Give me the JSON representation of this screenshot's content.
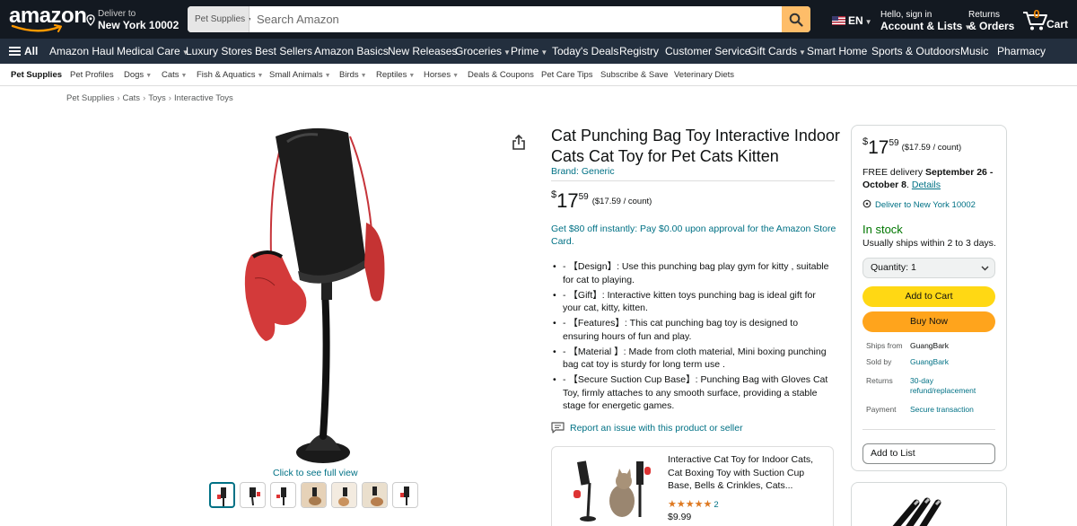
{
  "header": {
    "logo_text": "amazon",
    "deliver_to_label": "Deliver to",
    "deliver_to_location": "New York 10002",
    "search_category": "Pet Supplies",
    "search_placeholder": "Search Amazon",
    "language": "EN",
    "account_greeting": "Hello, sign in",
    "account_label": "Account & Lists",
    "returns_label": "Returns",
    "orders_label": "& Orders",
    "cart_count": "0",
    "cart_label": "Cart"
  },
  "nav": {
    "all_label": "All",
    "items": [
      "Amazon Haul",
      "Medical Care",
      "Luxury Stores",
      "Best Sellers",
      "Amazon Basics",
      "New Releases",
      "Groceries",
      "Prime",
      "Today's Deals",
      "Registry",
      "Customer Service",
      "Gift Cards",
      "Smart Home",
      "Sports & Outdoors",
      "Music",
      "Pharmacy"
    ]
  },
  "subnav": {
    "items": [
      "Pet Supplies",
      "Pet Profiles",
      "Dogs",
      "Cats",
      "Fish & Aquatics",
      "Small Animals",
      "Birds",
      "Reptiles",
      "Horses",
      "Deals & Coupons",
      "Pet Care Tips",
      "Subscribe & Save",
      "Veterinary Diets"
    ]
  },
  "breadcrumb": [
    "Pet Supplies",
    "Cats",
    "Toys",
    "Interactive Toys"
  ],
  "gallery": {
    "full_view_label": "Click to see full view",
    "thumbnail_count": 7
  },
  "product": {
    "title": "Cat Punching Bag Toy Interactive Indoor Cats Cat Toy for Pet Cats Kitten",
    "brand": "Brand: Generic",
    "price_symbol": "$",
    "price_whole": "17",
    "price_fraction": "59",
    "price_per_unit": "($17.59 / count)",
    "promo": "Get $80 off instantly: Pay $0.00 upon approval for the Amazon Store Card.",
    "bullets": [
      "- 【Design】: Use this punching bag play gym for kitty , suitable for cat to playing.",
      "- 【Gift】: Interactive kitten toys punching bag is ideal gift for your cat, kitty, kitten.",
      "- 【Features】: This cat punching bag toy is designed to ensuring hours of fun and play.",
      "- 【Material 】: Made from cloth material, Mini boxing punching bag cat toy is sturdy for long term use .",
      "- 【Secure Suction Cup Base】: Punching Bag with Gloves Cat Toy, firmly attaches to any smooth surface, providing a stable stage for energetic games."
    ],
    "report_issue": "Report an issue with this product or seller"
  },
  "sponsored": {
    "title": "Interactive Cat Toy for Indoor Cats, Cat Boxing Toy with Suction Cup Base, Bells & Crinkles, Cats...",
    "stars": "★★★★★",
    "rating_count": "2",
    "price": "$9.99"
  },
  "buybox": {
    "price_symbol": "$",
    "price_whole": "17",
    "price_fraction": "59",
    "price_per_unit": "($17.59 / count)",
    "delivery_prefix": "FREE delivery",
    "delivery_dates": "September 26 - October 8",
    "details_link": "Details",
    "deliver_to": "Deliver to New York 10002",
    "stock": "In stock",
    "ships_time": "Usually ships within 2 to 3 days.",
    "quantity_label": "Quantity:",
    "quantity_value": "1",
    "add_to_cart": "Add to Cart",
    "buy_now": "Buy Now",
    "ships_from_label": "Ships from",
    "ships_from_value": "GuangBark",
    "sold_by_label": "Sold by",
    "sold_by_value": "GuangBark",
    "returns_label": "Returns",
    "returns_value_1": "30-day",
    "returns_value_2": "refund/replacement",
    "payment_label": "Payment",
    "payment_value": "Secure transaction",
    "add_to_list": "Add to List"
  },
  "colors": {
    "header_bg": "#131921",
    "nav_bg": "#232f3e",
    "link": "#007185",
    "in_stock": "#007600",
    "add_to_cart": "#ffd814",
    "buy_now": "#ffa41c",
    "search_button": "#febd69"
  }
}
